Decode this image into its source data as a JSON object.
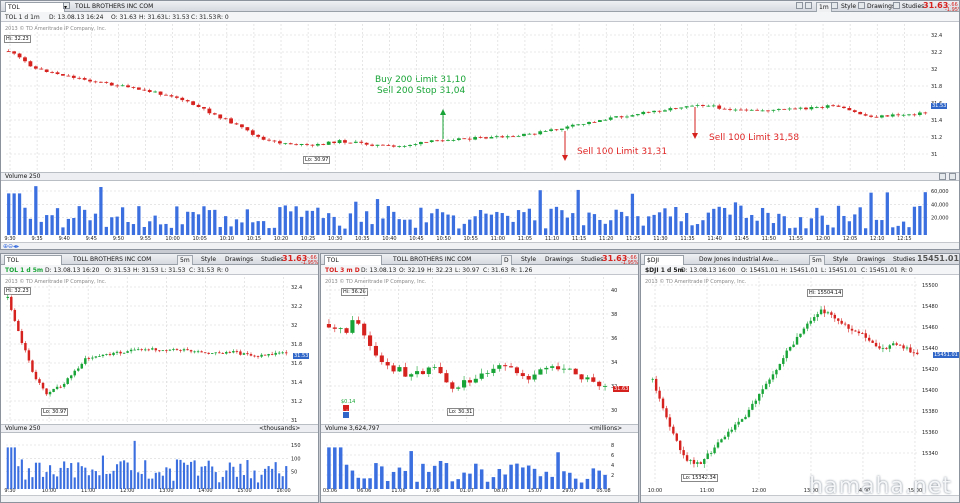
{
  "main": {
    "symbol": "TOL",
    "company": "TOLL BROTHERS INC COM",
    "interval_button": "1m",
    "style_label": "Style",
    "drawings_label": "Drawings",
    "studies_label": "Studies",
    "price": "31.63",
    "change": "-.66",
    "change_pct": "-1.95%",
    "ohlc": [
      "TOL 1 d 1m",
      "D: 13.08.13 16:24",
      "O: 31.63",
      "H: 31.63",
      "L: 31.53",
      "C: 31.53",
      "R: 0"
    ],
    "copyright": "2013 © TD Ameritrade IP Company, Inc.",
    "hi_label": "Hi: 32.23",
    "lo_label": "Lo: 30.97",
    "last_tag": "31.53",
    "annotations": {
      "buy": "Buy 200 Limit 31,10",
      "sell_stop": "Sell 200 Stop 31,04",
      "sell1": "Sell 100 Limit 31,31",
      "sell2": "Sell 100 Limit 31,58"
    },
    "price_ticks": [
      "32.4",
      "32.2",
      "32",
      "31.8",
      "31.6",
      "31.4",
      "31.2",
      "31"
    ],
    "volume_label": "Volume",
    "volume_value": "250",
    "volume_ticks": [
      "60,000",
      "40,000",
      "20,000"
    ],
    "time_ticks": [
      "9:30",
      "9:35",
      "9:40",
      "9:45",
      "9:50",
      "9:55",
      "10:00",
      "10:05",
      "10:10",
      "10:15",
      "10:20",
      "10:25",
      "10:30",
      "10:35",
      "10:40",
      "10:45",
      "10:50",
      "10:55",
      "11:00",
      "11:05",
      "11:10",
      "11:15",
      "11:20",
      "11:25",
      "11:30",
      "11:35",
      "11:40",
      "11:45",
      "11:50",
      "11:55",
      "12:00",
      "12:05",
      "12:10",
      "12:15"
    ]
  },
  "panel1": {
    "symbol": "TOL",
    "company": "TOLL BROTHERS INC COM",
    "interval_button": "5m",
    "style_label": "Style",
    "drawings_label": "Drawings",
    "studies_label": "Studies",
    "price": "31.63",
    "change": "-.66",
    "change_pct": "-1.95%",
    "ohlc": [
      "TOL 1 d 5m",
      "D: 13.08.13 16:20",
      "O: 31.53",
      "H: 31.53",
      "L: 31.53",
      "C: 31.53",
      "R: 0"
    ],
    "copyright": "2013 © TD Ameritrade IP Company, Inc.",
    "hi_label": "Hi: 32.23",
    "lo_label": "Lo: 30.97",
    "last_tag": "31.53",
    "price_ticks": [
      "32.4",
      "32.2",
      "32",
      "31.8",
      "31.6",
      "31.4",
      "31.2",
      "31"
    ],
    "volume_label": "Volume",
    "volume_value": "250",
    "volume_units": "<thousands>",
    "volume_ticks": [
      "150",
      "100",
      "50"
    ],
    "time_ticks": [
      "9:30",
      "10:00",
      "11:00",
      "12:00",
      "13:00",
      "14:00",
      "15:00",
      "16:00"
    ]
  },
  "panel2": {
    "symbol": "TOL",
    "company": "TOLL BROTHERS INC COM",
    "interval_button": "D",
    "style_label": "Style",
    "drawings_label": "Drawings",
    "studies_label": "Studies",
    "price": "31.63",
    "change": "-.66",
    "change_pct": "-1.95%",
    "ohlc": [
      "TOL 3 m D",
      "D: 13.08.13",
      "O: 32.19",
      "H: 32.23",
      "L: 30.97",
      "C: 31.63",
      "R: 1.26"
    ],
    "copyright": "2013 © TD Ameritrade IP Company, Inc.",
    "hi_label": "Hi: 36.26",
    "lo_label": "Lo: 30.31",
    "event_label": "$0.14",
    "last_tag": "31.63",
    "price_ticks": [
      "40",
      "38",
      "36",
      "34",
      "32",
      "30"
    ],
    "volume_label": "Volume",
    "volume_value": "3,624,797",
    "volume_units": "<millions>",
    "volume_ticks": [
      "8",
      "6",
      "4",
      "2"
    ],
    "time_ticks": [
      "03.06",
      "06.06",
      "11.06",
      "17.06",
      "01.07",
      "08.07",
      "15.07",
      "29.07",
      "05.08"
    ]
  },
  "panel3": {
    "symbol": "$DJI",
    "company": "Dow Jones Industrial Ave...",
    "interval_button": "5m",
    "style_label": "Style",
    "drawings_label": "Drawings",
    "studies_label": "Studies",
    "price": "15451.01",
    "ohlc": [
      "$DJI 1 d 5m",
      "D: 13.08.13 16:00",
      "O: 15451.01",
      "H: 15451.01",
      "L: 15451.01",
      "C: 15451.01",
      "R: 0"
    ],
    "copyright": "2013 © TD Ameritrade IP Company, Inc.",
    "hi_label": "Hi: 15504.14",
    "lo_label": "Lo: 15342.34",
    "last_tag": "15451.01",
    "price_ticks": [
      "15500",
      "15480",
      "15460",
      "15440",
      "15420",
      "15400",
      "15380",
      "15360",
      "15340"
    ],
    "time_ticks": [
      "10:00",
      "11:00",
      "12:00",
      "13:00",
      "14:00",
      "15:00"
    ]
  },
  "watermark": "hamaha.net",
  "colors": {
    "up": "#18a436",
    "down": "#d6221f",
    "volume": "#3b6fe0",
    "accent": "#d6221f"
  }
}
